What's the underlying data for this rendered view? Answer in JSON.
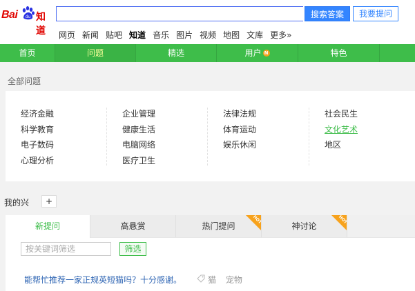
{
  "header": {
    "logo_text_latin": "Bai",
    "logo_text_du": "du",
    "logo_text_cn": "知道",
    "search_value": "",
    "search_button": "搜索答案",
    "ask_button": "我要提问"
  },
  "category_nav": [
    {
      "label": "网页",
      "active": false
    },
    {
      "label": "新闻",
      "active": false
    },
    {
      "label": "贴吧",
      "active": false
    },
    {
      "label": "知道",
      "active": true
    },
    {
      "label": "音乐",
      "active": false
    },
    {
      "label": "图片",
      "active": false
    },
    {
      "label": "视频",
      "active": false
    },
    {
      "label": "地图",
      "active": false
    },
    {
      "label": "文库",
      "active": false
    },
    {
      "label": "更多»",
      "active": false
    }
  ],
  "green_nav": [
    {
      "label": "首页",
      "active": false
    },
    {
      "label": "问题",
      "active": true
    },
    {
      "label": "精选",
      "active": false
    },
    {
      "label": "用户",
      "active": false,
      "badge": "N"
    },
    {
      "label": "特色",
      "active": false
    }
  ],
  "all_questions_label": "全部问题",
  "categories": [
    [
      "经济金融",
      "科学教育",
      "电子数码",
      "心理分析"
    ],
    [
      "企业管理",
      "健康生活",
      "电脑网络",
      "医疗卫生"
    ],
    [
      "法律法规",
      "体育运动",
      "娱乐休闲"
    ],
    [
      "社会民生",
      "文化艺术",
      "地区"
    ]
  ],
  "highlighted_category": "文化艺术",
  "my_interest_label": "我的兴",
  "add_interest_label": "+",
  "tabs": [
    {
      "label": "新提问",
      "active": true,
      "hot": false
    },
    {
      "label": "高悬赏",
      "active": false,
      "hot": false
    },
    {
      "label": "热门提问",
      "active": false,
      "hot": true
    },
    {
      "label": "神讨论",
      "active": false,
      "hot": true
    }
  ],
  "hot_badge": "HOT",
  "filter": {
    "placeholder": "按关键词筛选",
    "button": "筛选"
  },
  "question_item": {
    "title": "能帮忙推荐一家正规英短猫吗？十分感谢。",
    "tags": [
      "猫",
      "宠物"
    ]
  },
  "colors": {
    "brand_red": "#e10602",
    "green": "#3ebd4a",
    "blue": "#3385ff",
    "hot_orange": "#f7a21c",
    "link_blue": "#2d64b3"
  }
}
